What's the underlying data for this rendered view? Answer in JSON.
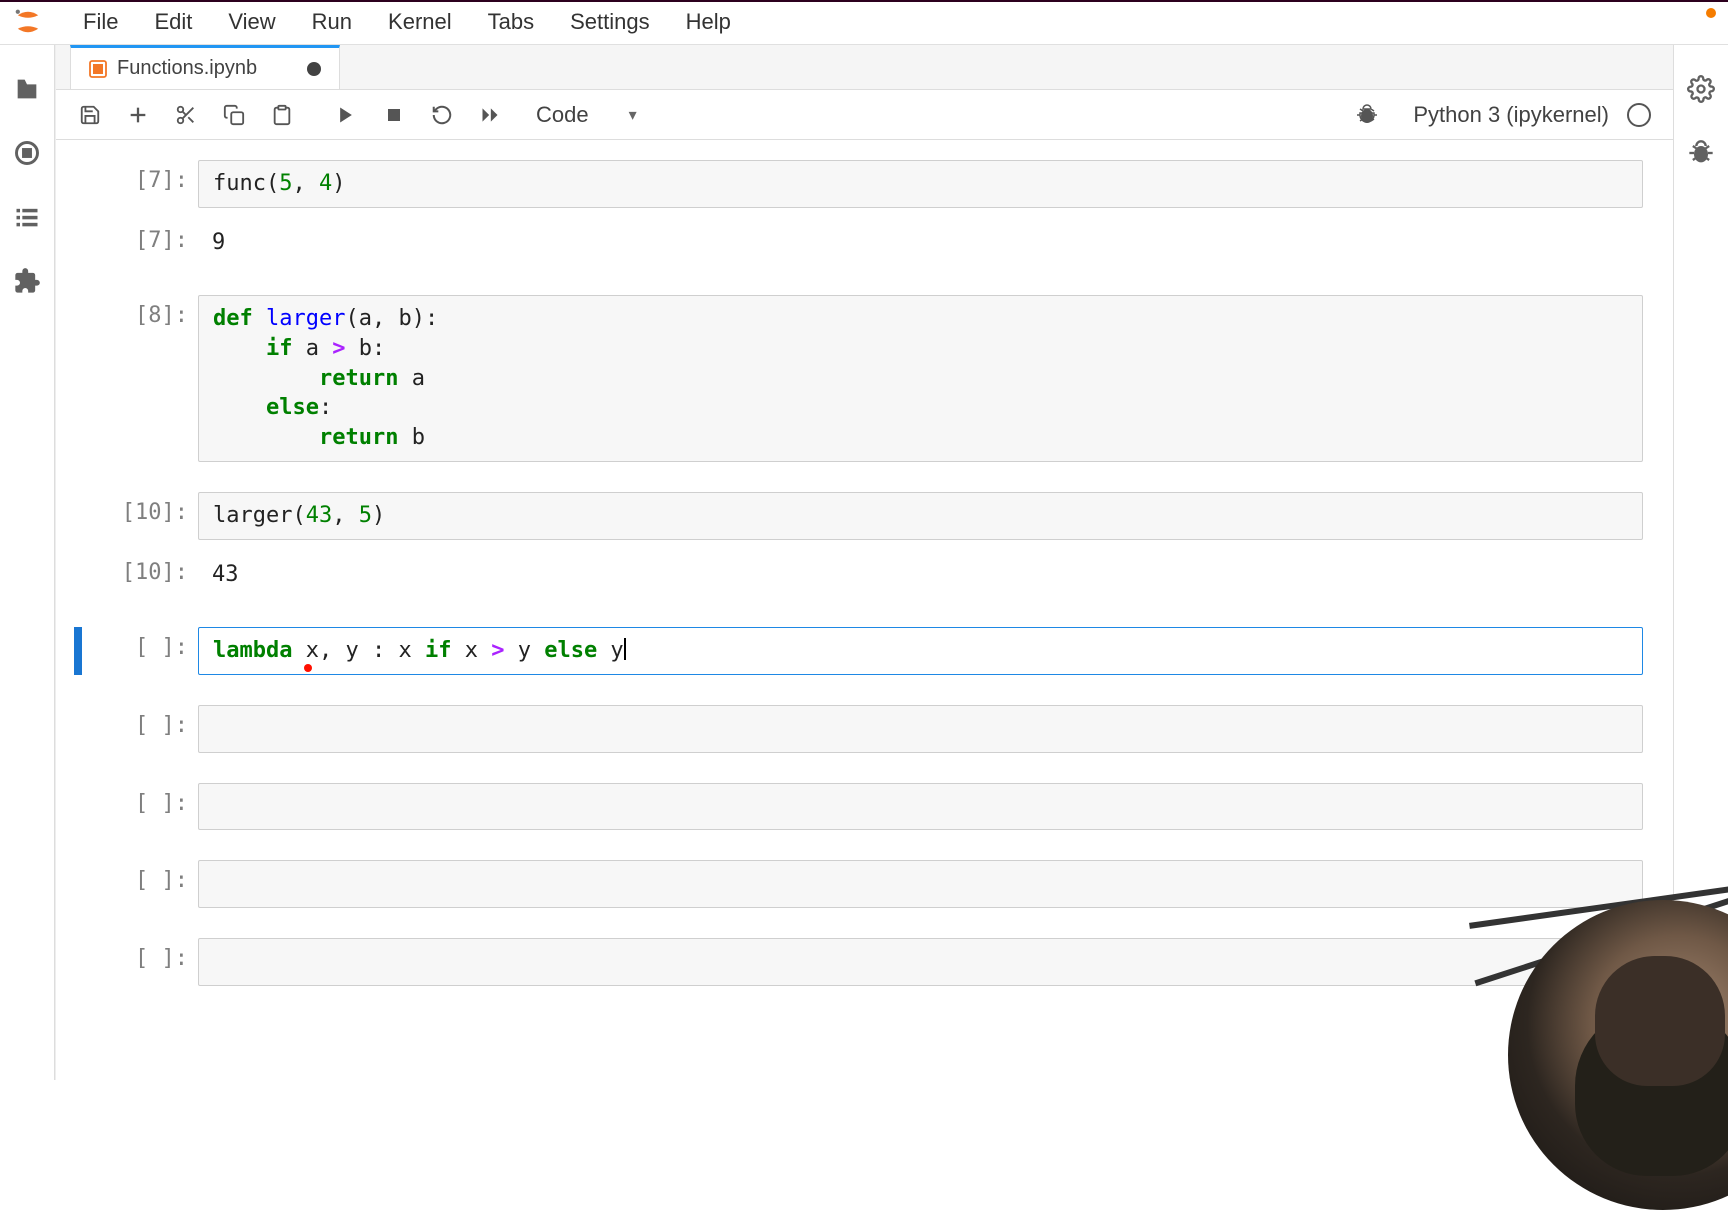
{
  "menu": {
    "items": [
      "File",
      "Edit",
      "View",
      "Run",
      "Kernel",
      "Tabs",
      "Settings",
      "Help"
    ]
  },
  "tab": {
    "title": "Functions.ipynb",
    "dirty": true
  },
  "toolbar": {
    "cell_type": "Code",
    "kernel_name": "Python 3 (ipykernel)"
  },
  "sidebar_left": {
    "items": [
      "folder",
      "running",
      "toc",
      "extensions"
    ]
  },
  "sidebar_right": {
    "items": [
      "gear",
      "debug"
    ]
  },
  "cells": [
    {
      "kind": "in",
      "prompt": "[7]:",
      "raw": "func(5, 4)"
    },
    {
      "kind": "out",
      "prompt": "[7]:",
      "raw": "9"
    },
    {
      "kind": "in",
      "prompt": "[8]:",
      "raw": "def larger(a, b):\n    if a > b:\n        return a\n    else:\n        return b"
    },
    {
      "kind": "in",
      "prompt": "[10]:",
      "raw": "larger(43, 5)"
    },
    {
      "kind": "out",
      "prompt": "[10]:",
      "raw": "43"
    },
    {
      "kind": "in",
      "prompt": "[ ]:",
      "raw": "lambda x, y : x if x > y else y",
      "active": true
    },
    {
      "kind": "in",
      "prompt": "[ ]:",
      "raw": ""
    },
    {
      "kind": "in",
      "prompt": "[ ]:",
      "raw": ""
    },
    {
      "kind": "in",
      "prompt": "[ ]:",
      "raw": ""
    },
    {
      "kind": "in",
      "prompt": "[ ]:",
      "raw": ""
    }
  ]
}
